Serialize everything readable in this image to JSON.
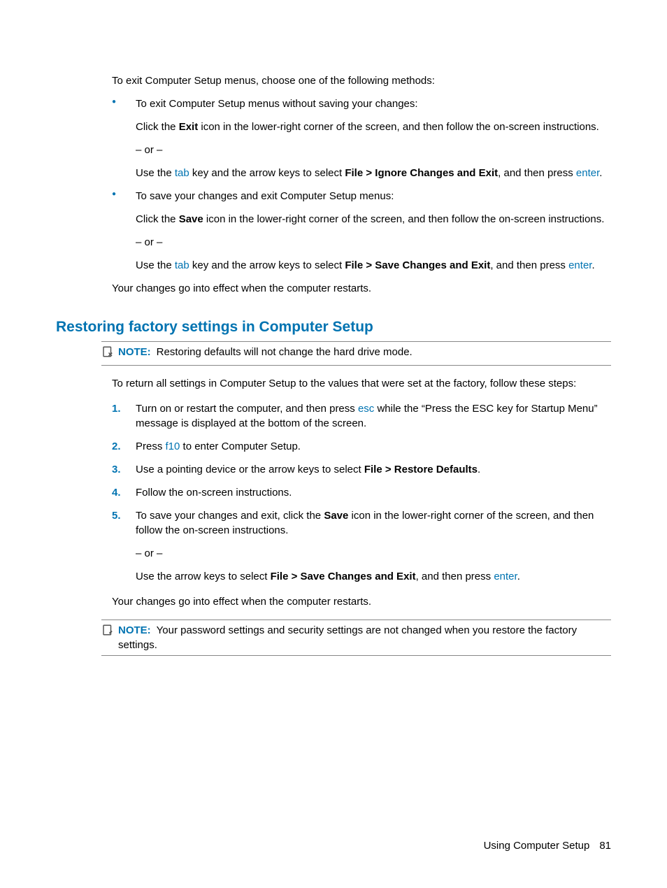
{
  "intro": "To exit Computer Setup menus, choose one of the following methods:",
  "bullets": [
    {
      "lead": "To exit Computer Setup menus without saving your changes:",
      "p1_a": "Click the ",
      "p1_bold": "Exit",
      "p1_b": " icon in the lower-right corner of the screen, and then follow the on-screen instructions.",
      "or": "– or –",
      "p2_a": "Use the ",
      "p2_key1": "tab",
      "p2_b": " key and the arrow keys to select ",
      "p2_bold": "File > Ignore Changes and Exit",
      "p2_c": ", and then press ",
      "p2_key2": "enter",
      "p2_d": "."
    },
    {
      "lead": "To save your changes and exit Computer Setup menus:",
      "p1_a": "Click the ",
      "p1_bold": "Save",
      "p1_b": " icon in the lower-right corner of the screen, and then follow the on-screen instructions.",
      "or": "– or –",
      "p2_a": "Use the ",
      "p2_key1": "tab",
      "p2_b": " key and the arrow keys to select ",
      "p2_bold": "File > Save Changes and Exit",
      "p2_c": ", and then press ",
      "p2_key2": "enter",
      "p2_d": "."
    }
  ],
  "afterBullets": "Your changes go into effect when the computer restarts.",
  "sectionTitle": "Restoring factory settings in Computer Setup",
  "note1": {
    "label": "NOTE:",
    "text": "Restoring defaults will not change the hard drive mode."
  },
  "afterNote1": "To return all settings in Computer Setup to the values that were set at the factory, follow these steps:",
  "steps": {
    "s1_a": "Turn on or restart the computer, and then press ",
    "s1_key": "esc",
    "s1_b": " while the “Press the ESC key for Startup Menu” message is displayed at the bottom of the screen.",
    "s2_a": "Press ",
    "s2_key": "f10",
    "s2_b": " to enter Computer Setup.",
    "s3_a": "Use a pointing device or the arrow keys to select ",
    "s3_bold": "File > Restore Defaults",
    "s3_b": ".",
    "s4": "Follow the on-screen instructions.",
    "s5_a": "To save your changes and exit, click the ",
    "s5_bold1": "Save",
    "s5_b": " icon in the lower-right corner of the screen, and then follow the on-screen instructions.",
    "s5_or": "– or –",
    "s5_c": "Use the arrow keys to select ",
    "s5_bold2": "File > Save Changes and Exit",
    "s5_d": ", and then press ",
    "s5_key": "enter",
    "s5_e": "."
  },
  "afterSteps": "Your changes go into effect when the computer restarts.",
  "note2": {
    "label": "NOTE:",
    "text": "Your password settings and security settings are not changed when you restore the factory settings."
  },
  "footer": {
    "section": "Using Computer Setup",
    "page": "81"
  }
}
